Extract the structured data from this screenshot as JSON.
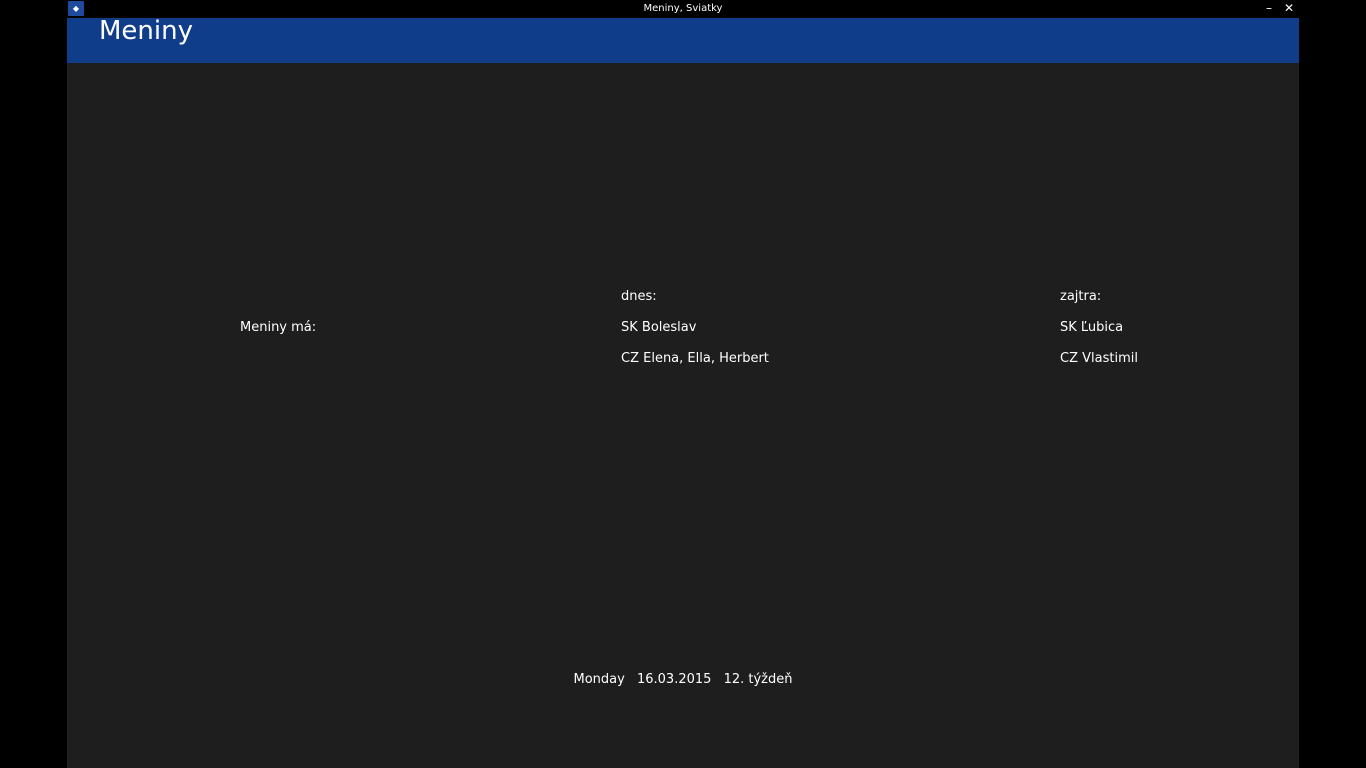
{
  "window": {
    "title": "Meniny, Sviatky",
    "icon": "app-icon",
    "minimize_glyph": "–",
    "close_glyph": "✕"
  },
  "header": {
    "title": "Meniny",
    "color": "#0f3d8a"
  },
  "content": {
    "label": "Meniny má:",
    "today": {
      "label": "dnes:",
      "sk": "SK Boleslav",
      "cz": "CZ Elena, Ella, Herbert"
    },
    "tomorrow": {
      "label": "zajtra:",
      "sk": "SK Ľubica",
      "cz": "CZ Vlastimil"
    }
  },
  "footer": {
    "weekday": "Monday",
    "date": "16.03.2015",
    "week": "12. týždeň"
  }
}
